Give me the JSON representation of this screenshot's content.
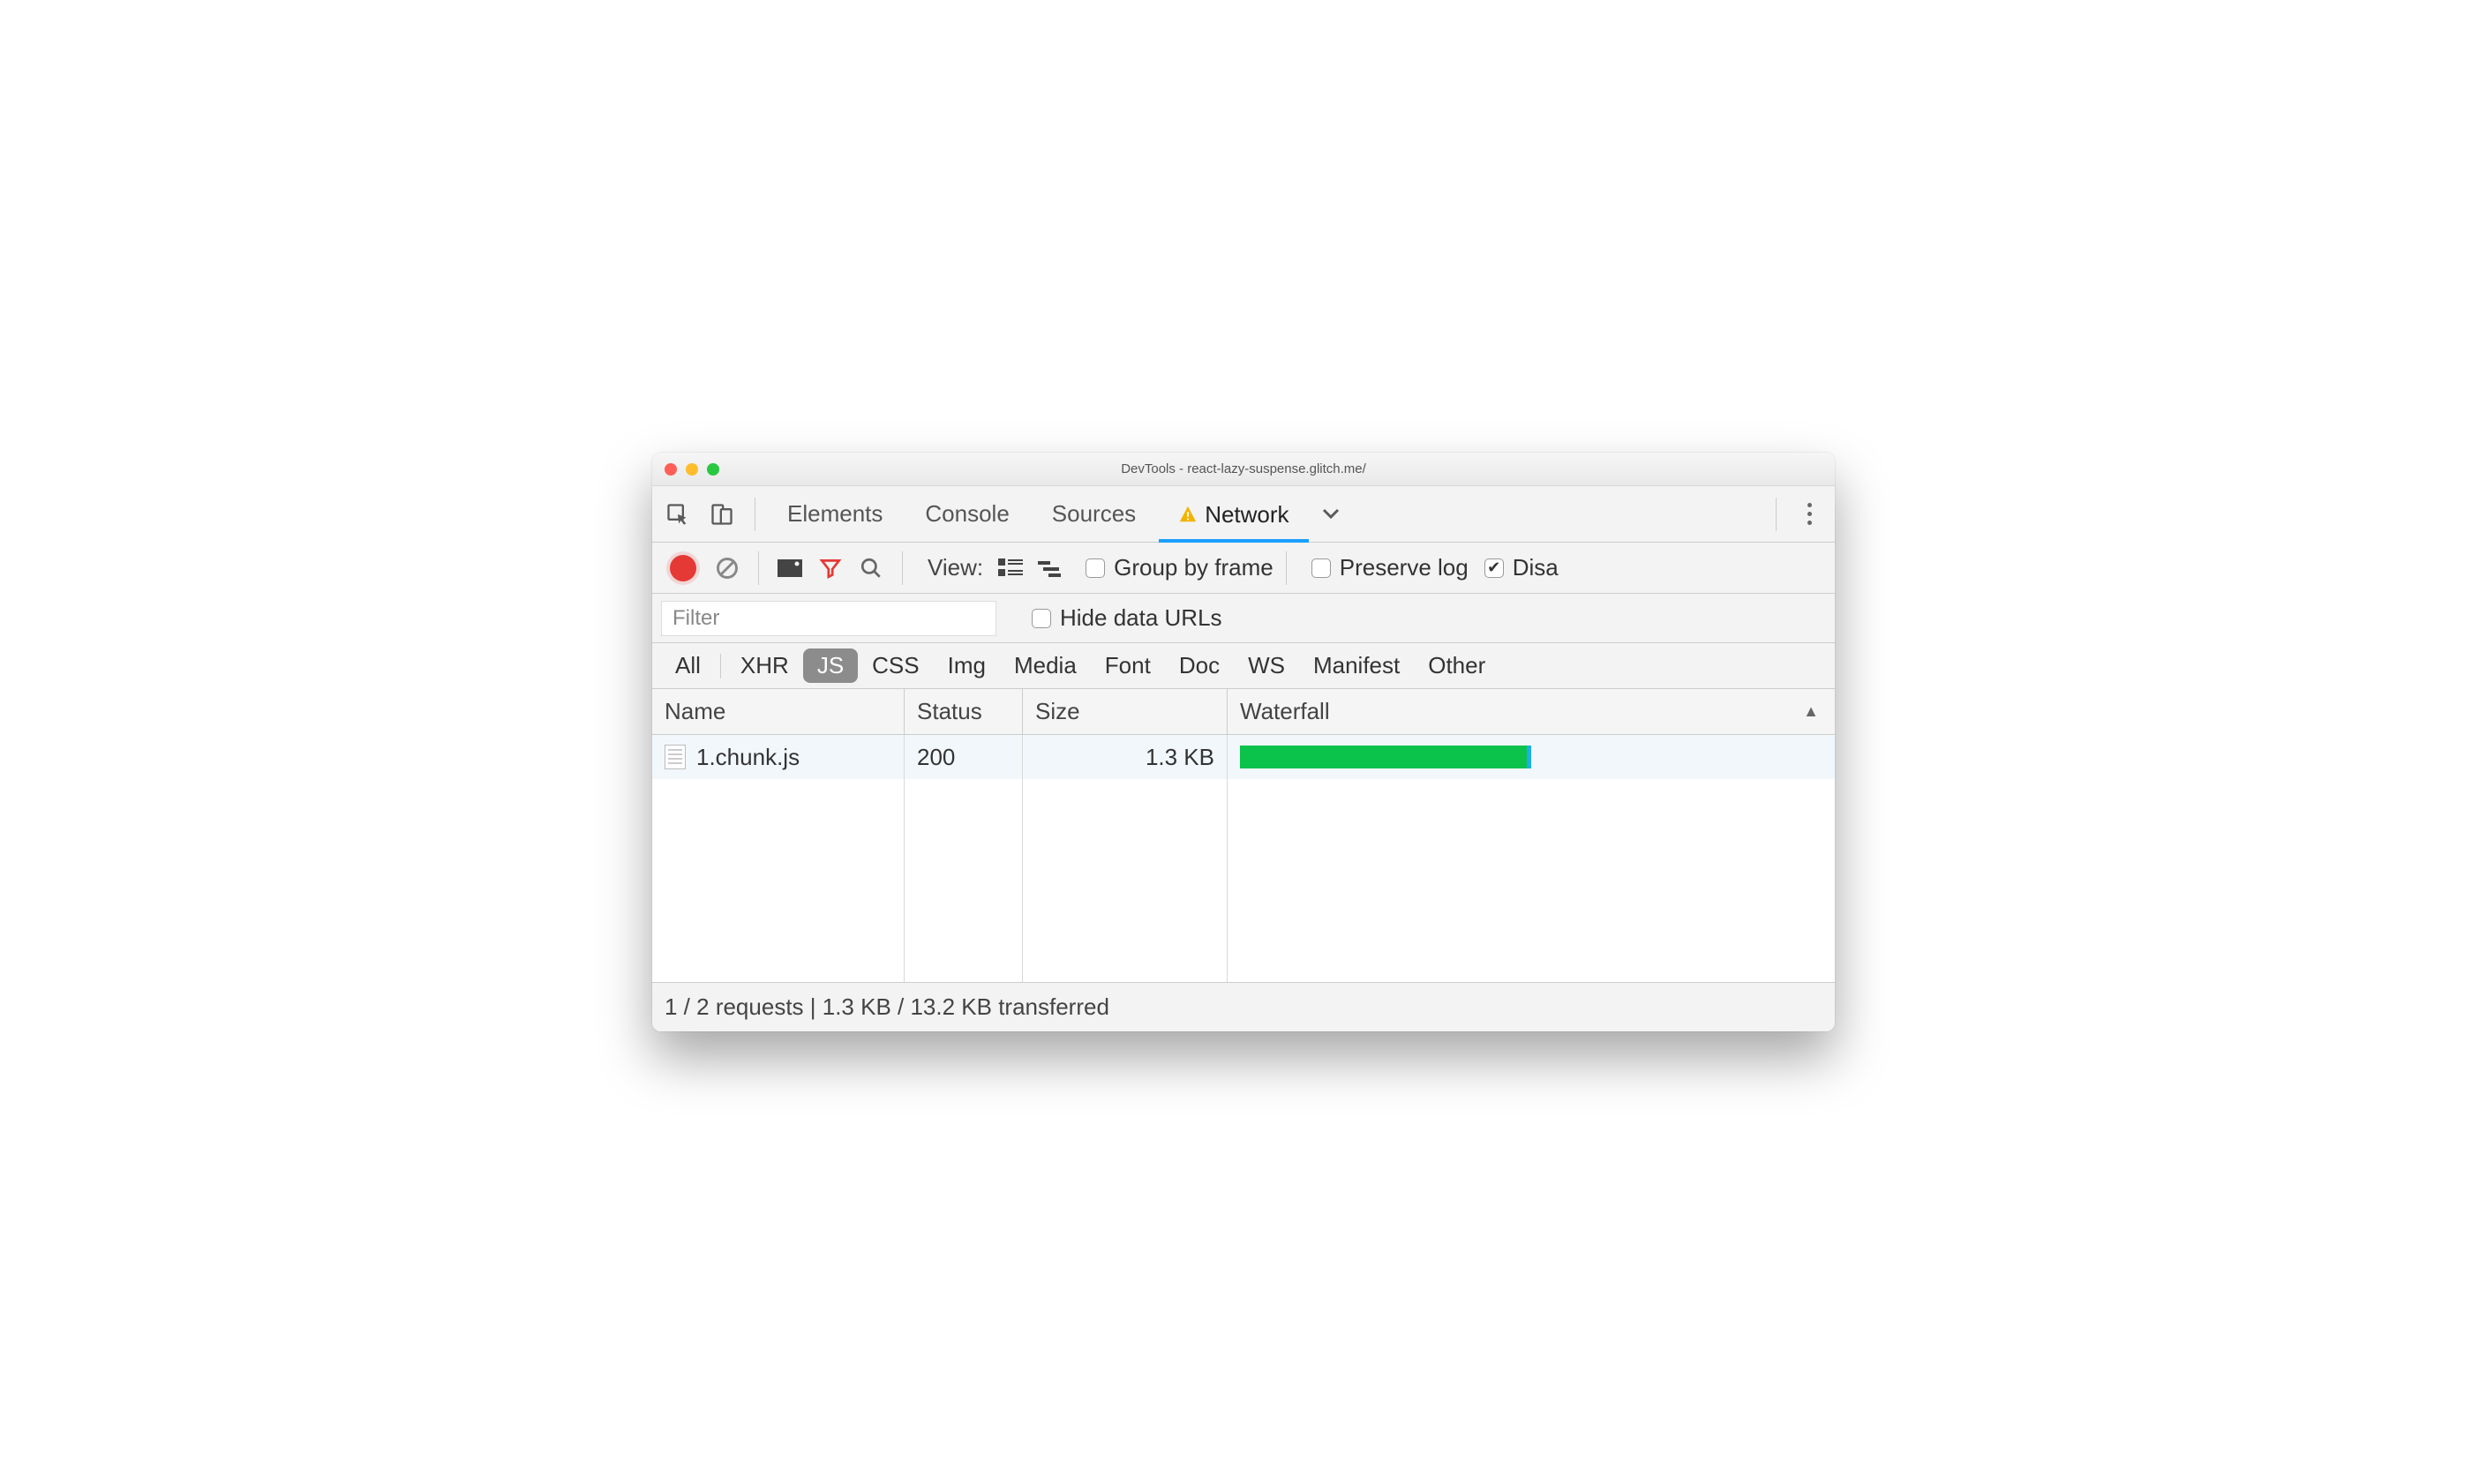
{
  "window": {
    "title": "DevTools - react-lazy-suspense.glitch.me/"
  },
  "tabs": {
    "items": [
      {
        "label": "Elements"
      },
      {
        "label": "Console"
      },
      {
        "label": "Sources"
      },
      {
        "label": "Network",
        "active": true,
        "warn": true
      }
    ]
  },
  "toolbar": {
    "view_label": "View:",
    "group_label": "Group by frame",
    "preserve_label": "Preserve log",
    "disable_label": "Disa"
  },
  "filter": {
    "placeholder": "Filter",
    "hide_label": "Hide data URLs"
  },
  "types": [
    "All",
    "XHR",
    "JS",
    "CSS",
    "Img",
    "Media",
    "Font",
    "Doc",
    "WS",
    "Manifest",
    "Other"
  ],
  "types_selected": "JS",
  "columns": {
    "name": "Name",
    "status": "Status",
    "size": "Size",
    "waterfall": "Waterfall"
  },
  "rows": [
    {
      "name": "1.chunk.js",
      "status": "200",
      "size": "1.3 KB",
      "wf_pct": 50
    }
  ],
  "footer": "1 / 2 requests | 1.3 KB / 13.2 KB transferred"
}
